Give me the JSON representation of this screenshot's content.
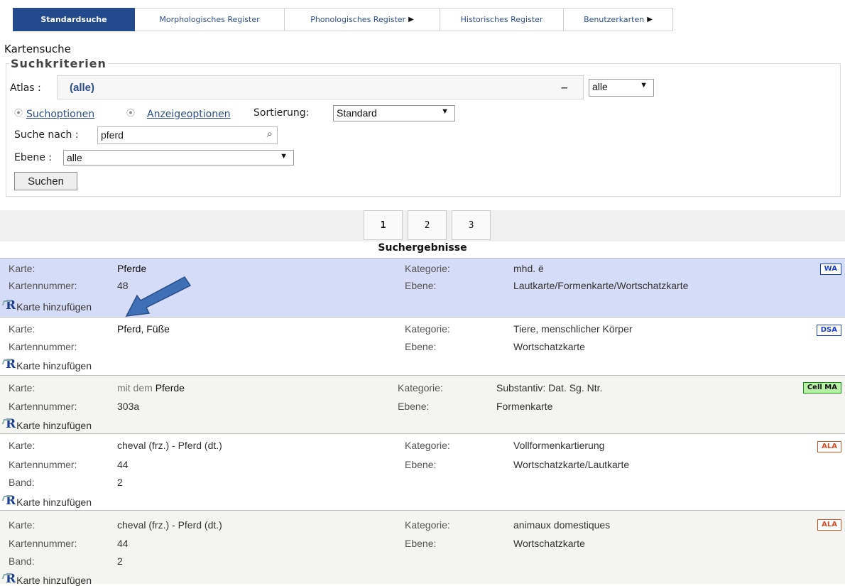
{
  "tabs": [
    {
      "label": "Standardsuche",
      "active": true,
      "arrow": ""
    },
    {
      "label": "Morphologisches Register",
      "active": false,
      "arrow": ""
    },
    {
      "label": "Phonologisches Register",
      "active": false,
      "arrow": "▶"
    },
    {
      "label": "Historisches Register",
      "active": false,
      "arrow": ""
    },
    {
      "label": "Benutzerkarten",
      "active": false,
      "arrow": "▶"
    }
  ],
  "search": {
    "heading": "Kartensuche",
    "legend": "Suchkriterien",
    "atlas_label": "Atlas :",
    "atlas_value": "(alle)",
    "atlas_dropdown": "‒",
    "atlas_scope": "alle",
    "suchoptionen": "Suchoptionen",
    "anzeigeoptionen": "Anzeigeoptionen",
    "sort_label": "Sortierung:",
    "sort_value": "Standard",
    "query_label": "Suche nach :",
    "query_value": "pferd",
    "ebene_label": "Ebene :",
    "ebene_value": "alle",
    "submit": "Suchen"
  },
  "pagination": {
    "pages": [
      "1",
      "2",
      "3"
    ],
    "current": "1"
  },
  "results_title": "Suchergebnisse",
  "labels": {
    "karte": "Karte:",
    "nummer": "Kartennummer:",
    "band": "Band:",
    "kategorie": "Kategorie:",
    "ebene": "Ebene:",
    "add": "Karte hinzufügen"
  },
  "results": [
    {
      "karte_prefix": "",
      "karte": "Pferde",
      "nummer": "48",
      "band": "",
      "kategorie": "mhd. ë",
      "ebene": "Lautkarte/Formenkarte/Wortschatzkarte",
      "badge": "WA",
      "badge_color": "#1a3fd0"
    },
    {
      "karte_prefix": "",
      "karte": "Pferd, Füße",
      "nummer": "",
      "band": "",
      "kategorie": "Tiere, menschlicher Körper",
      "ebene": "Wortschatzkarte",
      "badge": "DSA",
      "badge_color": "#1a3fd0"
    },
    {
      "karte_prefix": "mit dem ",
      "karte": "Pferde",
      "nummer": "303a",
      "band": "",
      "kategorie": "Substantiv: Dat. Sg. Ntr.",
      "ebene": "Formenkarte",
      "badge": "Cell MA",
      "badge_color": "#1a8c1a"
    },
    {
      "karte_prefix": "",
      "karte": "cheval (frz.) - Pferd (dt.)",
      "nummer": "44",
      "band": "2",
      "kategorie": "Vollformenkartierung",
      "ebene": "Wortschatzkarte/Lautkarte",
      "badge": "ALA",
      "badge_color": "#d0502a"
    },
    {
      "karte_prefix": "",
      "karte": "cheval (frz.) - Pferd (dt.)",
      "nummer": "44",
      "band": "2",
      "kategorie": "animaux domestiques",
      "ebene": "Wortschatzkarte",
      "badge": "ALA",
      "badge_color": "#d0502a"
    }
  ],
  "colors": {
    "tab_active": "#224a8c",
    "selected_row": "#d5dcf7",
    "arrow_annotation": "#3f6fb5"
  }
}
